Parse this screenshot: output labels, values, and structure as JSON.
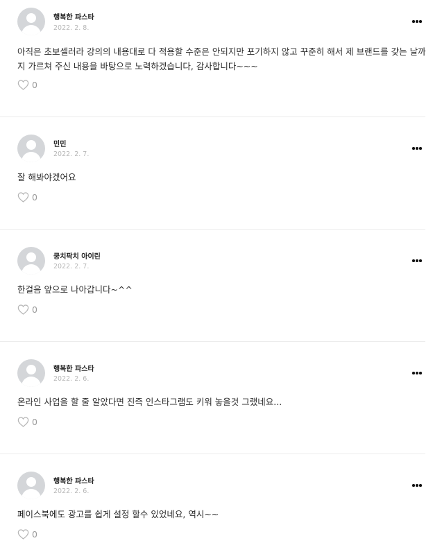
{
  "comments": [
    {
      "author": "행복한 파스타",
      "date": "2022. 2. 8.",
      "text": "아직은 초보셀러라 강의의 내용대로 다 적용할 수준은 안되지만 포기하지 않고 꾸준히 해서 제 브랜드를 갖는 날까지 가르쳐 주신 내용을 바탕으로 노력하겠습니다, 감사합니다~~~",
      "likes": "0"
    },
    {
      "author": "민민",
      "date": "2022. 2. 7.",
      "text": "잘 해봐야겠어요",
      "likes": "0"
    },
    {
      "author": "쿵치팍치 아이린",
      "date": "2022. 2. 7.",
      "text": "한걸음 앞으로 나아갑니다~^^",
      "likes": "0"
    },
    {
      "author": "행복한 파스타",
      "date": "2022. 2. 6.",
      "text": "온라인 사업을 할 줄 알았다면 진즉 인스타그램도 키워 놓을것 그랬네요...",
      "likes": "0"
    },
    {
      "author": "행복한 파스타",
      "date": "2022. 2. 6.",
      "text": "페이스북에도 광고를 쉽게 설정 할수 있었네요, 역시~~",
      "likes": "0"
    }
  ],
  "icons": {
    "avatar": "default-user-avatar-icon",
    "more": "more-options-dots-icon",
    "like": "heart-outline-icon"
  }
}
